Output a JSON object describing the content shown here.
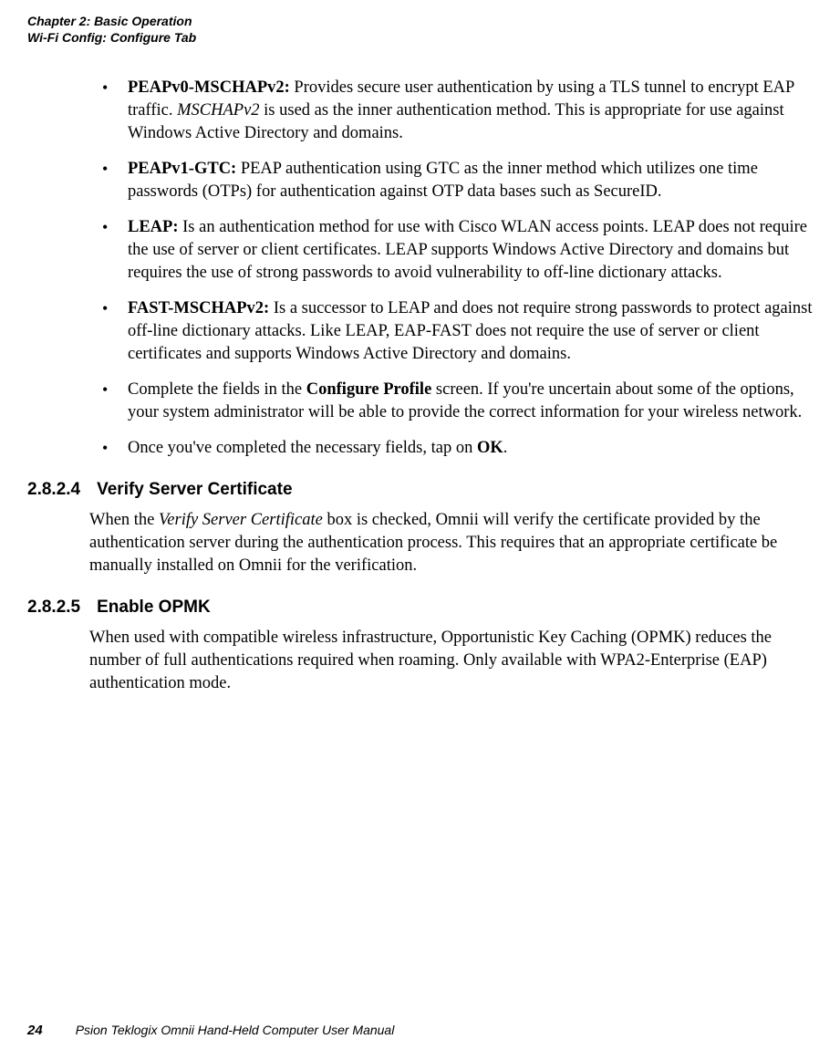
{
  "header": {
    "chapter": "Chapter 2:  Basic Operation",
    "section": "Wi-Fi Config: Configure Tab"
  },
  "bullets": [
    {
      "label": "PEAPv0-MSCHAPv2:",
      "text_part1": " Provides secure user authentication by using a TLS tunnel to encrypt EAP traffic. ",
      "italic": "MSCHAPv2",
      "text_part2": " is used as the inner authentication method. This is appropriate for use against Windows Active Directory and domains."
    },
    {
      "label": "PEAPv1-GTC:",
      "text": " PEAP authentication using GTC as the inner method which utilizes one time passwords (OTPs) for authentication against OTP data bases such as SecureID."
    },
    {
      "label": "LEAP:",
      "text": " Is an authentication method for use with Cisco WLAN access points. LEAP does not require the use of server or client certificates. LEAP supports Windows Active Directory and domains but requires the use of strong passwords to avoid vulnerability to off-line dictionary attacks."
    },
    {
      "label": "FAST-MSCHAPv2:",
      "text": " Is a successor to LEAP and does not require strong passwords to protect against off-line dictionary attacks. Like LEAP, EAP-FAST does not require the use of server or client certificates and supports Windows Active Directory and domains."
    },
    {
      "pre": "Complete the fields in the ",
      "bold_mid": "Configure Profile",
      "post": " screen. If you're uncertain about some of the options, your system administrator will be able to provide the correct information for your wireless network."
    },
    {
      "pre": "Once you've completed the necessary fields, tap on ",
      "bold_mid": "OK",
      "post": "."
    }
  ],
  "section_2824": {
    "number": "2.8.2.4",
    "title": "Verify Server Certificate",
    "body_pre": "When the ",
    "body_italic": "Verify Server Certificate",
    "body_post": " box is checked, Omnii will verify the certificate provided by the authentication server during the authentication process. This requires that an appropriate certificate be manually installed on Omnii for the verification."
  },
  "section_2825": {
    "number": "2.8.2.5",
    "title": "Enable OPMK",
    "body": "When used with compatible wireless infrastructure, Opportunistic Key Caching (OPMK) reduces the number of full authentications required when roaming. Only available with WPA2-Enterprise (EAP) authentication mode."
  },
  "footer": {
    "page": "24",
    "text": "Psion Teklogix Omnii Hand-Held Computer User Manual"
  }
}
